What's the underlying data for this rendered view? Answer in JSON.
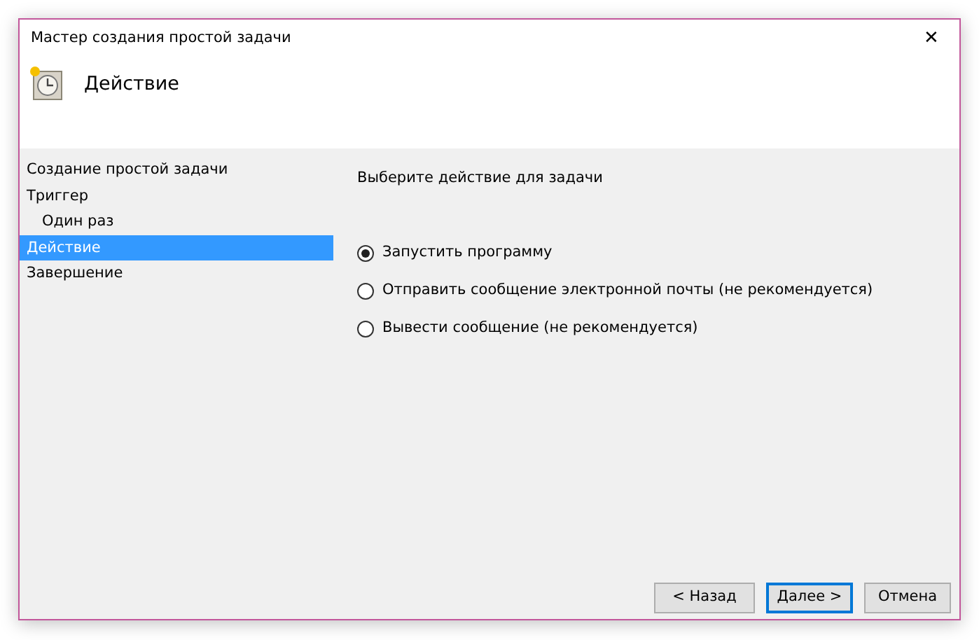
{
  "window": {
    "title": "Мастер создания простой задачи",
    "close": "✕"
  },
  "header": {
    "title": "Действие"
  },
  "sidebar": {
    "items": [
      {
        "label": "Создание простой задачи",
        "selected": false
      },
      {
        "label": "Триггер",
        "selected": false,
        "children": [
          {
            "label": "Один раз",
            "selected": false
          }
        ]
      },
      {
        "label": "Действие",
        "selected": true
      },
      {
        "label": "Завершение",
        "selected": false
      }
    ]
  },
  "content": {
    "prompt": "Выберите действие для задачи",
    "options": [
      {
        "label": "Запустить программу",
        "selected": true
      },
      {
        "label": "Отправить сообщение электронной почты (не рекомендуется)",
        "selected": false
      },
      {
        "label": "Вывести сообщение (не рекомендуется)",
        "selected": false
      }
    ]
  },
  "buttons": [
    {
      "label": "< Назад",
      "kind": "normal"
    },
    {
      "label": "Далее >",
      "kind": "default"
    },
    {
      "label": "Отмена",
      "kind": "normal"
    }
  ]
}
